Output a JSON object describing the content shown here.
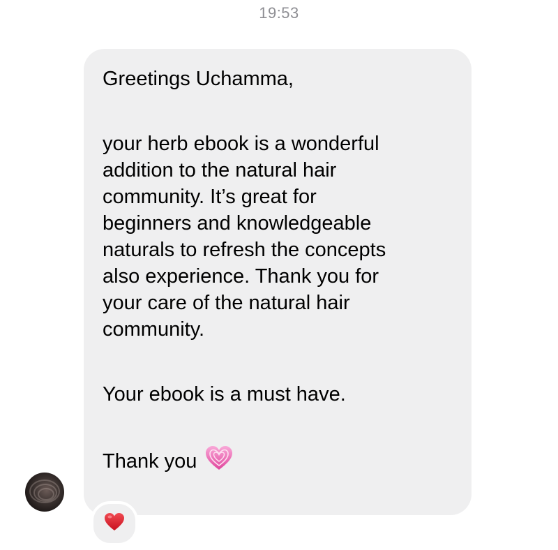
{
  "timestamp": "19:53",
  "message": {
    "greeting": "Greetings Uchamma,",
    "body_lines": [
      "your herb ebook is a wonderful",
      "addition to the natural hair",
      "community. It’s great for",
      "beginners and knowledgeable",
      "naturals to refresh the concepts",
      "also experience. Thank you for",
      "your care of the natural hair",
      "community."
    ],
    "highlight": "Your ebook is a must have.",
    "closing": "Thank you",
    "closing_icon": "sparkling-pink-heart-icon"
  },
  "avatar": {
    "icon": "sender-avatar"
  },
  "reaction": {
    "icon": "red-heart-icon",
    "color": "#e0202e"
  },
  "colors": {
    "bubble": "#efeff0",
    "timestamp": "#8e8e93",
    "text": "#000000",
    "heart_pink": "#f25ab0"
  }
}
